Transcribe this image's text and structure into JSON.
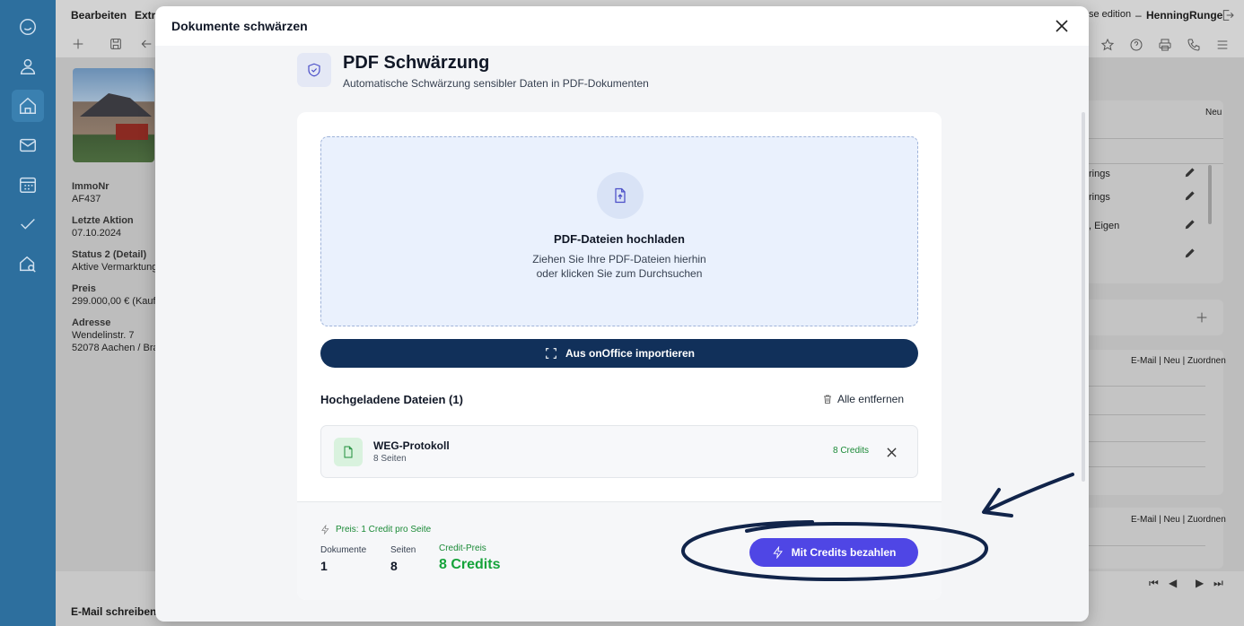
{
  "app": {
    "menu": [
      "Bearbeiten",
      "Extra"
    ],
    "edition_fragment": "se edition",
    "separator": "–",
    "username": "HenningRunge",
    "property": {
      "immo_label": "ImmoNr",
      "immo_value": "AF437",
      "last_action_label": "Letzte Aktion",
      "last_action_value": "07.10.2024",
      "status_label": "Status 2 (Detail)",
      "status_value": "Aktive Vermarktung",
      "price_label": "Preis",
      "price_value": "299.000,00 € (Kauf",
      "address_label": "Adresse",
      "address_line1": "Wendelinstr. 7",
      "address_line2": "52078 Aachen / Bra"
    },
    "right_panel": {
      "neu": "Neu",
      "row1": "rings",
      "row2": "rings",
      "row3": ", Eigen",
      "links1": "E-Mail | Neu | Zuordnen",
      "links2": "E-Mail | Neu | Zuordnen"
    },
    "bottom_left": "E-Mail schreiben"
  },
  "modal": {
    "title": "Dokumente schwärzen",
    "hero_title": "PDF Schwärzung",
    "hero_subtitle": "Automatische Schwärzung sensibler Daten in PDF-Dokumenten",
    "dropzone": {
      "title": "PDF-Dateien hochladen",
      "line1": "Ziehen Sie Ihre PDF-Dateien hierhin",
      "line2": "oder klicken Sie zum Durchsuchen"
    },
    "import_label": "Aus onOffice importieren",
    "uploaded_heading": "Hochgeladene Dateien (1)",
    "remove_all_label": "Alle entfernen",
    "files": [
      {
        "name": "WEG-Protokoll",
        "pages": "8 Seiten",
        "credits": "8 Credits"
      }
    ],
    "footer": {
      "price_line": "Preis: 1 Credit pro Seite",
      "documents_label": "Dokumente",
      "documents_value": "1",
      "pages_label": "Seiten",
      "pages_value": "8",
      "credit_price_label": "Credit-Preis",
      "credit_price_value": "8 Credits",
      "pay_label": "Mit Credits bezahlen"
    }
  },
  "colors": {
    "accent": "#4f46e5",
    "import_button": "#11305a",
    "credits_green": "#15a33a",
    "sidebar": "#2d6f9e",
    "annotation": "#11244a"
  }
}
